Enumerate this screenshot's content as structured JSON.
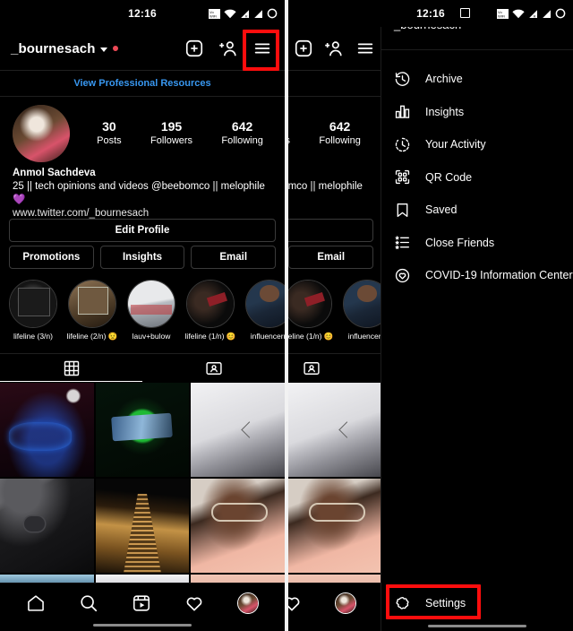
{
  "status_bar": {
    "time": "12:16",
    "icons": [
      "vowifi-icon",
      "wifi-icon",
      "signal-roaming-icon",
      "signal-icon",
      "battery-icon"
    ],
    "right_extra_icon": "image-icon"
  },
  "header": {
    "username": "_bournesach",
    "chevron": "chevron-down-icon",
    "unread_dot": true,
    "actions": [
      "add-post-icon",
      "add-person-icon",
      "hamburger-menu-icon"
    ]
  },
  "professional": {
    "link_label": "View Professional Resources",
    "link_color": "#3897f0"
  },
  "profile": {
    "avatar": "profile-avatar",
    "stats": [
      {
        "value": "30",
        "label": "Posts"
      },
      {
        "value": "195",
        "label": "Followers"
      },
      {
        "value": "642",
        "label": "Following"
      }
    ],
    "display_name": "Anmol Sachdeva",
    "bio": "25 || tech opinions and videos @beebomco || melophile 💜",
    "website": "www.twitter.com/_bournesach"
  },
  "buttons": {
    "edit_profile": "Edit Profile",
    "promotions": "Promotions",
    "insights": "Insights",
    "email": "Email"
  },
  "highlights": [
    {
      "label": "lifeline (3/n)",
      "art": "ph-h1"
    },
    {
      "label": "lifeline (2/n) 😟",
      "art": "ph-h2"
    },
    {
      "label": "lauv+bulow",
      "art": "ph-h3"
    },
    {
      "label": "lifeline (1/n) 😊",
      "art": "ph-h4"
    },
    {
      "label": "influencerrr",
      "art": "ph-h5"
    }
  ],
  "tabs": [
    {
      "name": "grid-tab",
      "icon": "grid-icon",
      "active": true
    },
    {
      "name": "tagged-tab",
      "icon": "tagged-person-icon",
      "active": false
    }
  ],
  "grid_posts": [
    {
      "alt": "neon-sign-post",
      "art": "ph-neon"
    },
    {
      "alt": "phone-gaming-post",
      "art": "ph-green"
    },
    {
      "alt": "white-laptop-post",
      "art": "ph-laptop"
    },
    {
      "alt": "black-phone-back-post",
      "art": "ph-phoneback"
    },
    {
      "alt": "night-building-post",
      "art": "ph-building"
    },
    {
      "alt": "selfie-post",
      "art": "ph-selfie"
    },
    {
      "alt": "strip-post-a",
      "art": "ph-strip-a"
    },
    {
      "alt": "strip-post-b",
      "art": "ph-strip-b"
    },
    {
      "alt": "strip-post-c",
      "art": "ph-strip-c"
    }
  ],
  "bottom_nav": [
    {
      "name": "nav-home",
      "icon": "home-icon"
    },
    {
      "name": "nav-search",
      "icon": "search-icon"
    },
    {
      "name": "nav-reels",
      "icon": "reels-icon"
    },
    {
      "name": "nav-activity",
      "icon": "heart-icon"
    },
    {
      "name": "nav-profile",
      "icon": "avatar-icon"
    }
  ],
  "drawer": {
    "username": "_bournesach",
    "items": [
      {
        "label": "Archive",
        "icon": "archive-clock-icon"
      },
      {
        "label": "Insights",
        "icon": "insights-bar-chart-icon"
      },
      {
        "label": "Your Activity",
        "icon": "your-activity-clock-icon"
      },
      {
        "label": "QR Code",
        "icon": "qr-code-icon"
      },
      {
        "label": "Saved",
        "icon": "bookmark-icon"
      },
      {
        "label": "Close Friends",
        "icon": "close-friends-star-list-icon"
      },
      {
        "label": "COVID-19 Information Center",
        "icon": "covid-info-icon"
      }
    ],
    "settings": {
      "label": "Settings",
      "icon": "gear-icon"
    }
  },
  "annotations": {
    "box_color": "#fd0d0d",
    "boxes": [
      {
        "name": "hamburger-highlight",
        "target": "hamburger-menu-icon"
      },
      {
        "name": "settings-highlight",
        "target": "settings-menu-item"
      }
    ]
  }
}
